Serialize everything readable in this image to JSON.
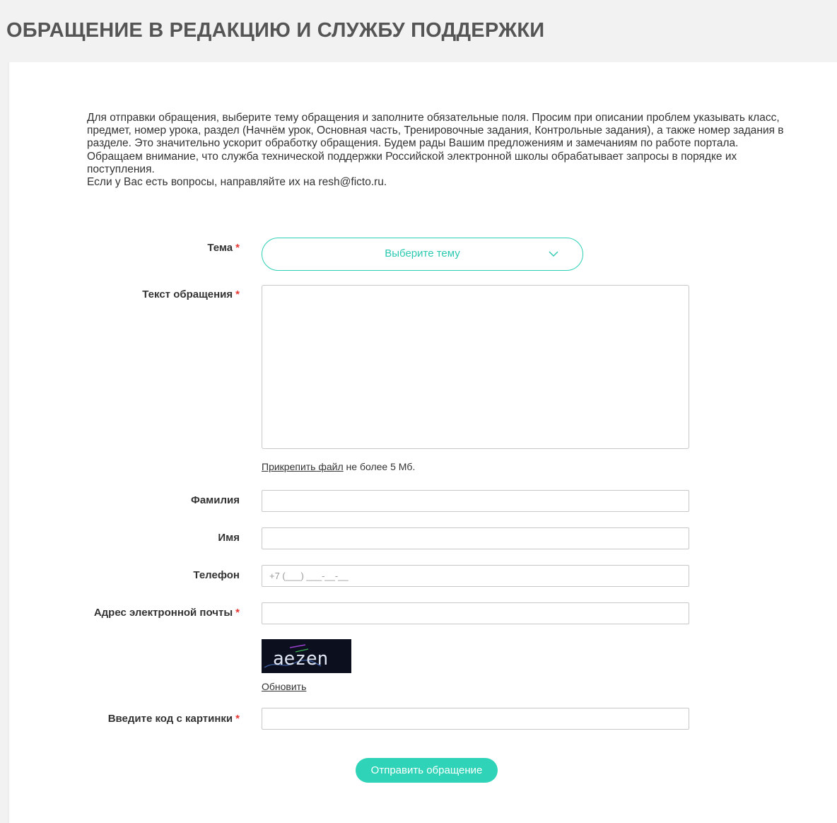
{
  "page": {
    "title": "ОБРАЩЕНИЕ В РЕДАКЦИЮ И СЛУЖБУ ПОДДЕРЖКИ"
  },
  "intro": {
    "line1": "Для отправки обращения, выберите тему обращения и заполните обязательные поля. Просим при описании проблем указывать класс, предмет, номер урока, раздел (Начнём урок, Основная часть, Тренировочные задания, Контрольные задания), а также номер задания в разделе. Это значительно ускорит обработку обращения. Будем рады Вашим предложениям и замечаниям по работе портала.",
    "line2": "Обращаем внимание, что служба технической поддержки Российской электронной школы обрабатывает запросы в порядке их поступления.",
    "line3": "Если у Вас есть вопросы, направляйте их на resh@ficto.ru."
  },
  "form": {
    "required_mark": "*",
    "topic": {
      "label": "Тема",
      "value": "Выберите тему"
    },
    "message": {
      "label": "Текст обращения",
      "value": ""
    },
    "attach": {
      "link": "Прикрепить файл",
      "note": " не более 5 Мб."
    },
    "surname": {
      "label": "Фамилия",
      "value": ""
    },
    "name": {
      "label": "Имя",
      "value": ""
    },
    "phone": {
      "label": "Телефон",
      "placeholder": "+7 (___) ___-__-__"
    },
    "email": {
      "label": "Адрес электронной почты",
      "value": ""
    },
    "captcha": {
      "text": "aezen",
      "refresh": "Обновить"
    },
    "code": {
      "label": "Введите код с картинки",
      "value": ""
    },
    "submit": "Отправить обращение"
  },
  "colors": {
    "accent": "#2fd3b8",
    "required": "#e53935",
    "header_bg": "#f2f2f2"
  }
}
